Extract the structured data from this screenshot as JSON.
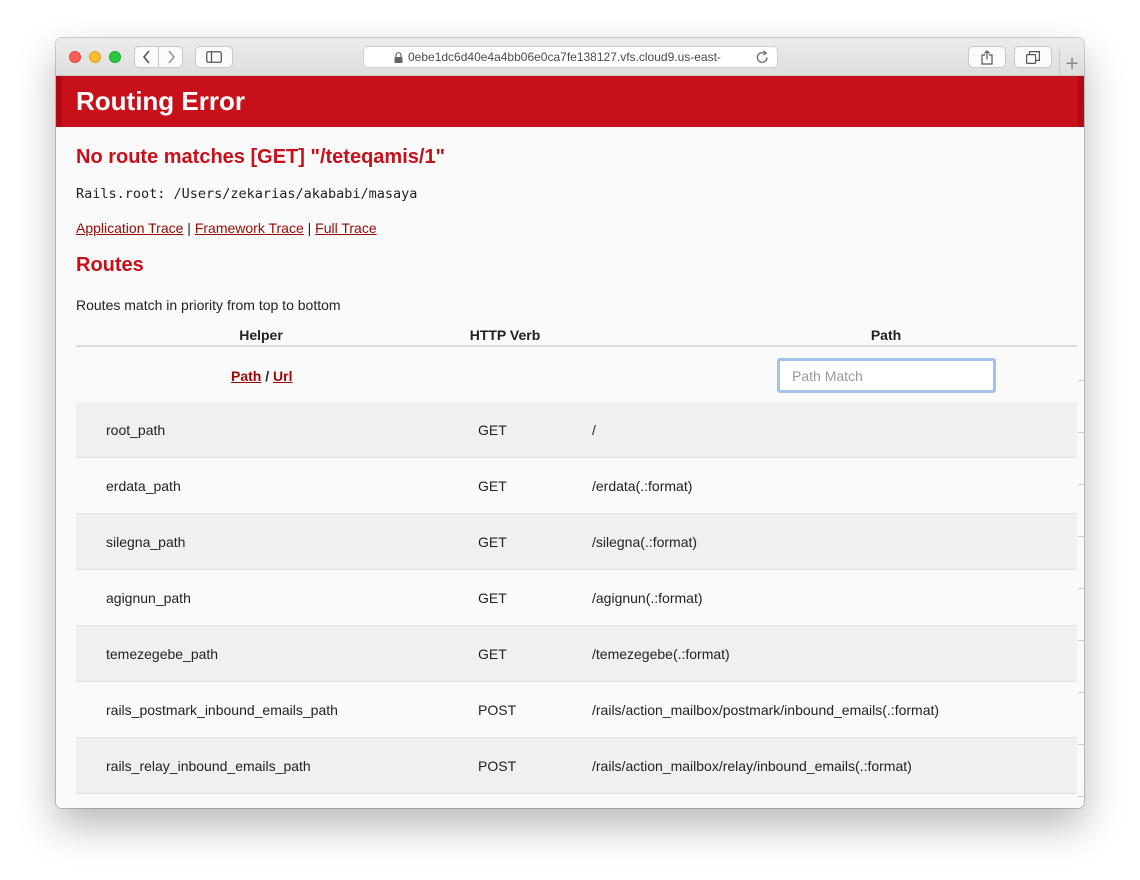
{
  "browser": {
    "url": "0ebe1dc6d40e4a4bb06e0ca7fe138127.vfs.cloud9.us-east-",
    "new_tab_label": "+"
  },
  "page": {
    "header_title": "Routing Error",
    "error_message": "No route matches [GET] \"/teteqamis/1\"",
    "rails_root": "Rails.root: /Users/zekarias/akababi/masaya",
    "traces": {
      "application": "Application Trace",
      "framework": "Framework Trace",
      "full": "Full Trace",
      "separator": "|"
    },
    "routes_title": "Routes",
    "routes_description": "Routes match in priority from top to bottom",
    "table": {
      "headers": {
        "helper": "Helper",
        "verb": "HTTP Verb",
        "path": "Path"
      },
      "helper_links": {
        "path": "Path",
        "separator": "/",
        "url": "Url"
      },
      "path_filter_placeholder": "Path Match",
      "rows": [
        {
          "helper": "root_path",
          "verb": "GET",
          "path": "/"
        },
        {
          "helper": "erdata_path",
          "verb": "GET",
          "path": "/erdata(.:format)"
        },
        {
          "helper": "silegna_path",
          "verb": "GET",
          "path": "/silegna(.:format)"
        },
        {
          "helper": "agignun_path",
          "verb": "GET",
          "path": "/agignun(.:format)"
        },
        {
          "helper": "temezegebe_path",
          "verb": "GET",
          "path": "/temezegebe(.:format)"
        },
        {
          "helper": "rails_postmark_inbound_emails_path",
          "verb": "POST",
          "path": "/rails/action_mailbox/postmark/inbound_emails(.:format)"
        },
        {
          "helper": "rails_relay_inbound_emails_path",
          "verb": "POST",
          "path": "/rails/action_mailbox/relay/inbound_emails(.:format)"
        }
      ]
    }
  }
}
